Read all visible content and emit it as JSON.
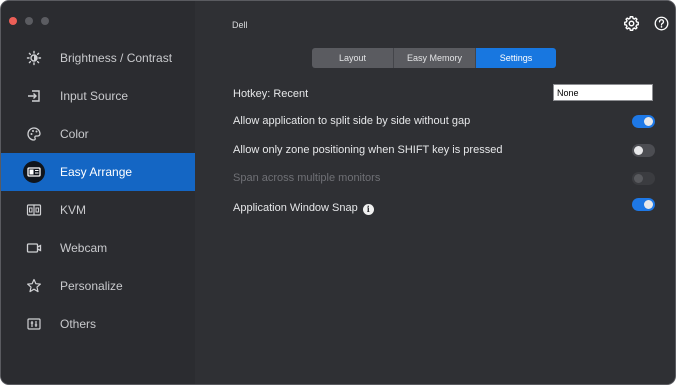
{
  "window": {
    "title": "Dell",
    "traffic_lights": {
      "close_color": "#ec5f57",
      "minimize_color": "#5b5c61",
      "zoom_color": "#5b5c61"
    }
  },
  "toolbar": {
    "settings_icon": "gear-icon",
    "help_icon": "question-circle-icon"
  },
  "sidebar": {
    "items": [
      {
        "label": "Brightness / Contrast",
        "icon": "sun-icon",
        "active": false
      },
      {
        "label": "Input Source",
        "icon": "input-arrow-icon",
        "active": false
      },
      {
        "label": "Color",
        "icon": "palette-icon",
        "active": false
      },
      {
        "label": "Easy Arrange",
        "icon": "layout-window-icon",
        "active": true
      },
      {
        "label": "KVM",
        "icon": "kvm-icon",
        "active": false
      },
      {
        "label": "Webcam",
        "icon": "camera-icon",
        "active": false
      },
      {
        "label": "Personalize",
        "icon": "star-icon",
        "active": false
      },
      {
        "label": "Others",
        "icon": "sliders-icon",
        "active": false
      }
    ]
  },
  "tabs": [
    {
      "label": "Layout",
      "selected": false
    },
    {
      "label": "Easy Memory",
      "selected": false
    },
    {
      "label": "Settings",
      "selected": true
    }
  ],
  "settings": {
    "hotkey": {
      "label": "Hotkey: Recent",
      "value": "None"
    },
    "rows": [
      {
        "label": "Allow application to split side by side without gap",
        "state": "on",
        "enabled": true
      },
      {
        "label": "Allow only zone positioning when SHIFT key is pressed",
        "state": "off",
        "enabled": true
      },
      {
        "label": "Span across multiple monitors",
        "state": "off",
        "enabled": false
      },
      {
        "label": "Application Window Snap",
        "state": "on",
        "enabled": true,
        "info_icon": "info-icon"
      }
    ]
  },
  "colors": {
    "accent": "#1877e0",
    "sidebar_active": "#1466c4",
    "background": "#2f3034",
    "sidebar_background": "#2b2c30"
  }
}
